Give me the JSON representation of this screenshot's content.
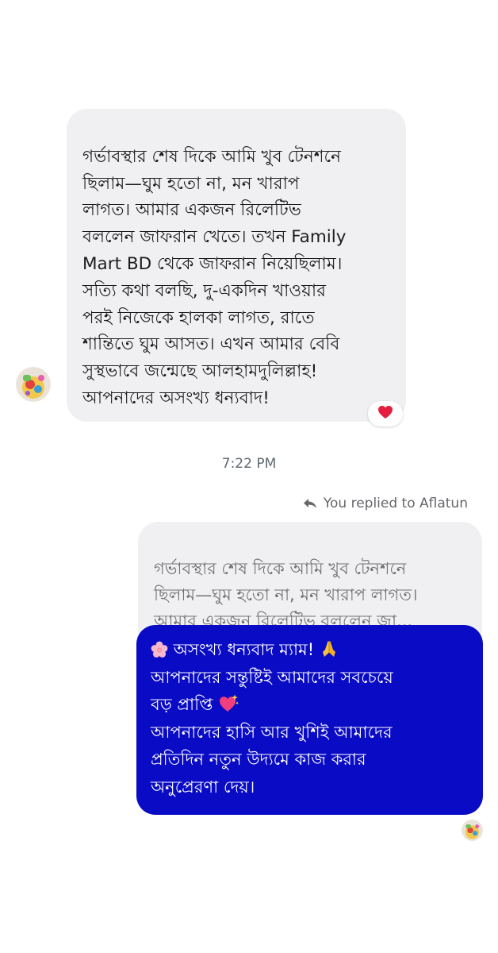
{
  "incoming_message": {
    "text": "গর্ভাবস্থার শেষ দিকে আমি খুব টেনশনে\nছিলাম—ঘুম হতো না, মন খারাপ\nলাগত। আমার একজন রিলেটিভ\nবললেন জাফরান খেতে। তখন Family\nMart BD  থেকে জাফরান নিয়েছিলাম।\nসত্যি কথা বলছি, দু-একদিন খাওয়ার\nপরই নিজেকে হালকা লাগত, রাতে\nশান্তিতে ঘুম আসত। এখন আমার বেবি\nসুস্থভাবে জন্মেছে আলহামদুলিল্লাহ!\nআপনাদের অসংখ্য ধন্যবাদ!",
    "reaction_icon": "heart-icon",
    "reaction_color": "#e41e3f"
  },
  "timestamp": "7:22 PM",
  "reply_header": {
    "icon": "reply-arrow-icon",
    "text": "You replied to Aflatun"
  },
  "quoted_message": {
    "text": "গর্ভাবস্থার শেষ দিকে আমি খুব টেনশনে\nছিলাম—ঘুম হতো না, মন খারাপ লাগত।\nআমার একজন রিলেটিভ বললেন জা..."
  },
  "outgoing_message": {
    "line1": "অসংখ্য ধন্যবাদ ম্যাম!",
    "line2": "আপনাদের সন্তুষ্টিই আমাদের সবচেয়ে",
    "line3": "বড় প্রাপ্তি",
    "line4": "আপনাদের হাসি আর খুশিই আমাদের",
    "line5": "প্রতিদিন নতুন উদ্যমে কাজ করার",
    "line6": "অনুপ্রেরণা দেয়।",
    "emojis": [
      "cherry-blossom-icon",
      "folded-hands-icon",
      "sparkling-heart-icon"
    ],
    "bubble_color": "#0a0bc4"
  }
}
